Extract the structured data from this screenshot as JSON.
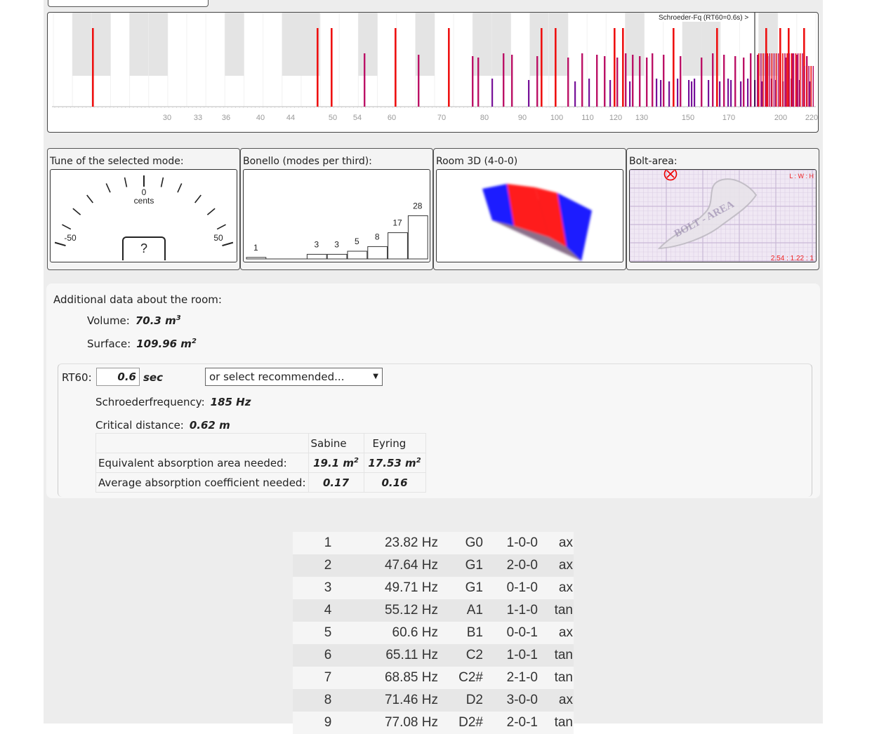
{
  "spectrum": {
    "schroeder_label": "Schroeder-Fq (RT60=0.6s) >",
    "tick_labels": [
      "30",
      "33",
      "36",
      "40",
      "44",
      "50",
      "54",
      "60",
      "70",
      "80",
      "90",
      "100",
      "110",
      "120",
      "130",
      "150",
      "170",
      "200",
      "220"
    ],
    "colors": {
      "axial": "#ee1111",
      "tangential": "#bb1166",
      "oblique": "#771199"
    }
  },
  "panels": {
    "tune": {
      "title": "Tune of the selected mode:",
      "zero_label": "0",
      "unit_label": "cents",
      "min_label": "-50",
      "max_label": "50",
      "note_value": "?"
    },
    "bonello": {
      "title": "Bonello (modes per third):",
      "values": [
        1,
        0,
        0,
        3,
        3,
        5,
        8,
        17,
        28
      ]
    },
    "room3d": {
      "title": "Room 3D (4-0-0)",
      "colors": {
        "positive": "#ff1a1a",
        "negative": "#1a1aff"
      }
    },
    "bolt": {
      "title": "Bolt-area:",
      "ratio_label": "L : W : H",
      "ratio_value": "2.54 : 1.22 : 1",
      "watermark": "BOLT - AREA"
    }
  },
  "additional": {
    "title": "Additional data about the room:",
    "volume_label": "Volume:",
    "volume_value": "70.3 m",
    "volume_sup": "3",
    "surface_label": "Surface:",
    "surface_value": "109.96 m",
    "surface_sup": "2",
    "rt60_label": "RT60:",
    "rt60_value": "0.6",
    "rt60_unit": "sec",
    "rt60_select": "or select recommended...",
    "schroeder_label": "Schroederfrequency:",
    "schroeder_value": "185 Hz",
    "critical_label": "Critical distance:",
    "critical_value": "0.62 m",
    "table": {
      "col_sabine": "Sabine",
      "col_eyring": "Eyring",
      "row1_label": "Equivalent absorption area needed:",
      "row1_sabine": "19.1 m",
      "row1_eyring": "17.53 m",
      "row1_sup": "2",
      "row2_label": "Average absorption coefficient needed:",
      "row2_sabine": "0.17",
      "row2_eyring": "0.16"
    }
  },
  "modes": [
    {
      "n": "1",
      "freq": "23.82 Hz",
      "note": "G0",
      "index": "1-0-0",
      "kind": "ax"
    },
    {
      "n": "2",
      "freq": "47.64 Hz",
      "note": "G1",
      "index": "2-0-0",
      "kind": "ax"
    },
    {
      "n": "3",
      "freq": "49.71 Hz",
      "note": "G1",
      "index": "0-1-0",
      "kind": "ax"
    },
    {
      "n": "4",
      "freq": "55.12 Hz",
      "note": "A1",
      "index": "1-1-0",
      "kind": "tan"
    },
    {
      "n": "5",
      "freq": "60.6 Hz",
      "note": "B1",
      "index": "0-0-1",
      "kind": "ax"
    },
    {
      "n": "6",
      "freq": "65.11 Hz",
      "note": "C2",
      "index": "1-0-1",
      "kind": "tan"
    },
    {
      "n": "7",
      "freq": "68.85 Hz",
      "note": "C2#",
      "index": "2-1-0",
      "kind": "tan"
    },
    {
      "n": "8",
      "freq": "71.46 Hz",
      "note": "D2",
      "index": "3-0-0",
      "kind": "ax"
    },
    {
      "n": "9",
      "freq": "77.08 Hz",
      "note": "D2#",
      "index": "2-0-1",
      "kind": "tan"
    }
  ]
}
